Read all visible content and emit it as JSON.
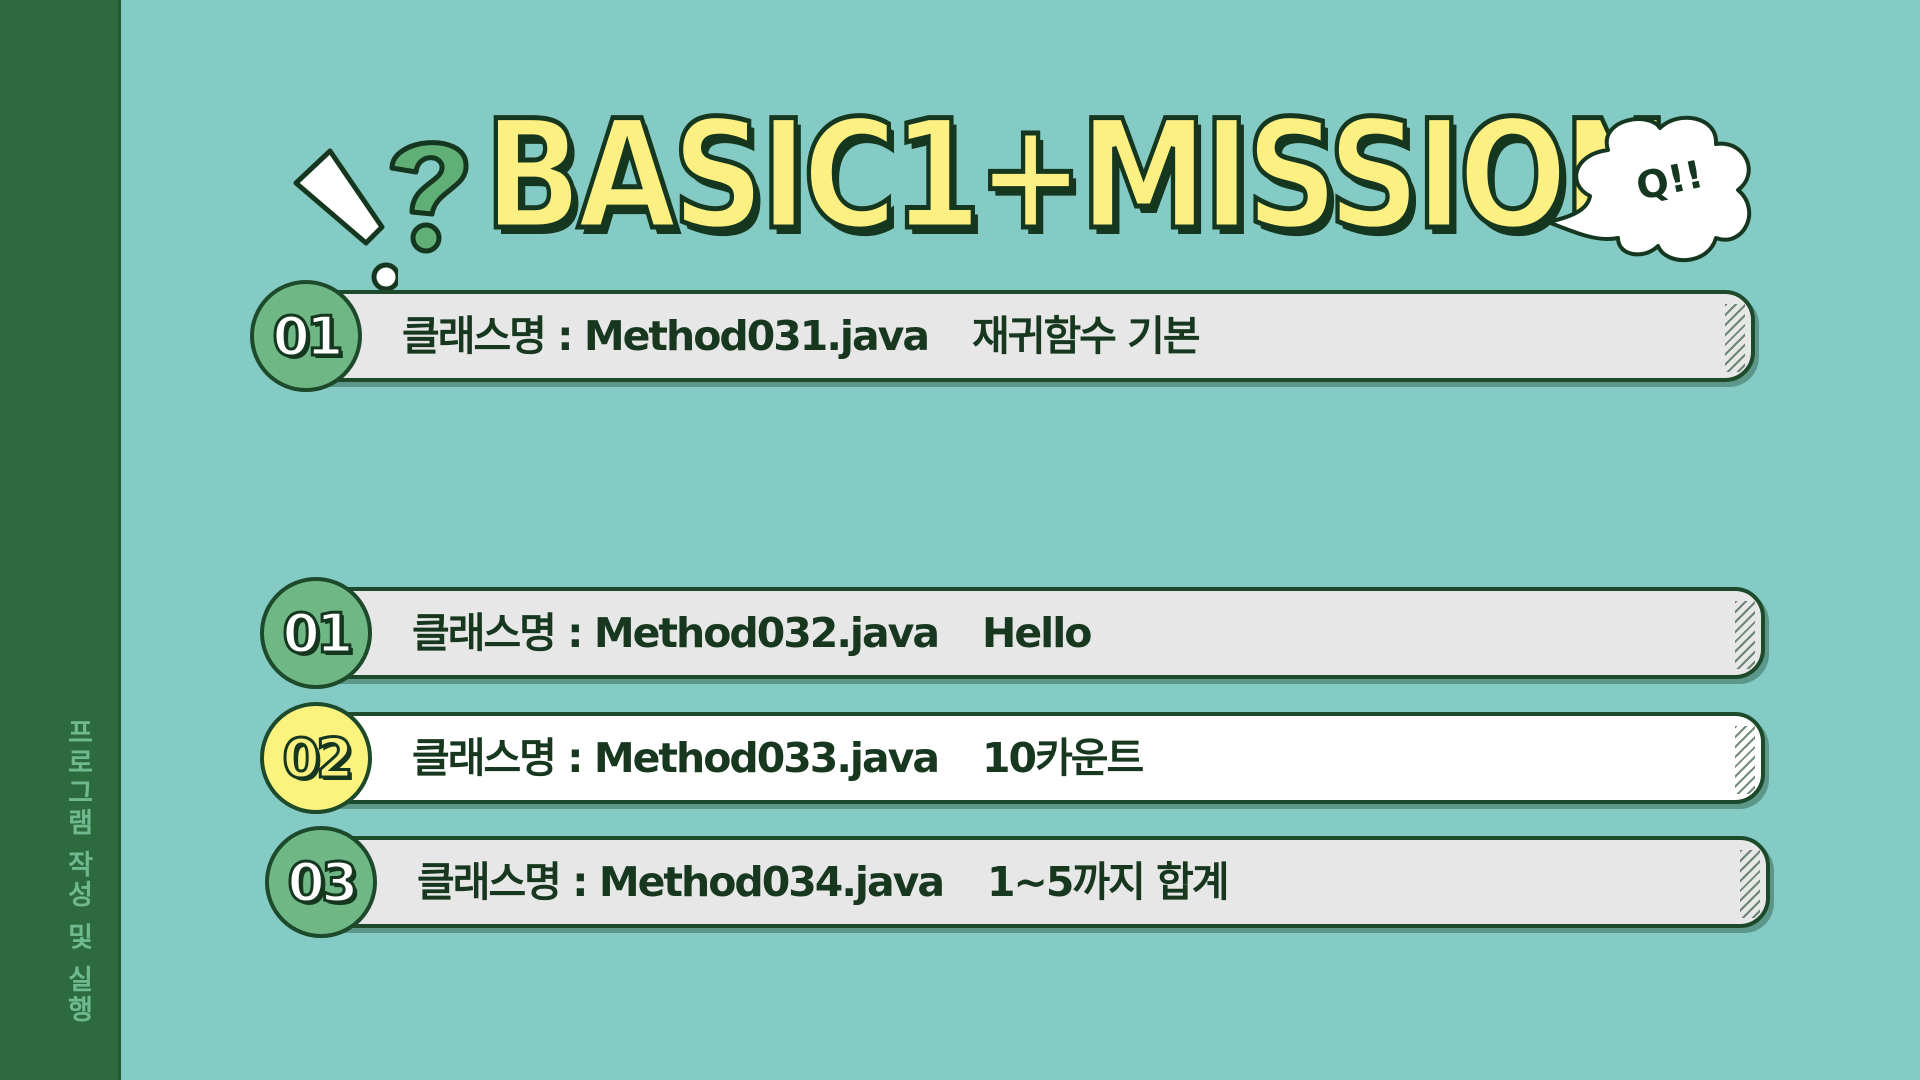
{
  "sidebar": {
    "label": "프로그램 작성 및 실행"
  },
  "title": {
    "text": "BASIC1+MISSION",
    "bubble": "Q!!"
  },
  "sections": [
    {
      "items": [
        {
          "number": "01",
          "class_label": "클래스명 : Method031.java",
          "description": "재귀함수 기본",
          "highlight": false
        }
      ]
    },
    {
      "items": [
        {
          "number": "01",
          "class_label": "클래스명 : Method032.java",
          "description": "Hello",
          "highlight": false
        },
        {
          "number": "02",
          "class_label": "클래스명 : Method033.java",
          "description": "10카운트",
          "highlight": true
        },
        {
          "number": "03",
          "class_label": "클래스명 : Method034.java",
          "description": "1~5까지 합계",
          "highlight": false
        }
      ]
    }
  ],
  "colors": {
    "background": "#83cbc4",
    "sidebar": "#2d6b3e",
    "title_fill": "#fdf083",
    "outline": "#16371f",
    "badge_green": "#6fb886",
    "badge_yellow": "#fbf37d"
  }
}
